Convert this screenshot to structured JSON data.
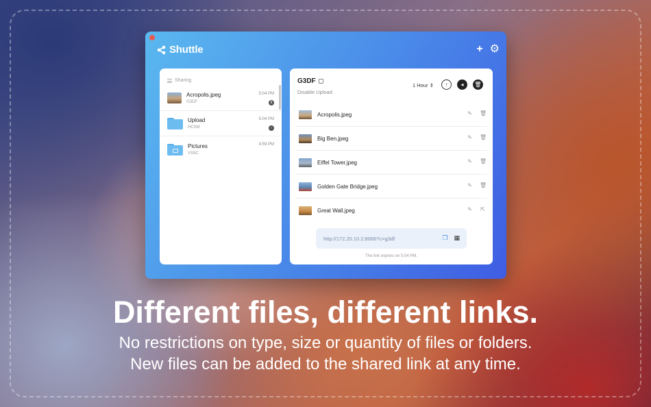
{
  "app": {
    "name": "Shuttle",
    "add_icon": "plus-icon",
    "settings_icon": "gear-icon"
  },
  "sidebar": {
    "section_label": "Sharing",
    "items": [
      {
        "name": "Acropolis.jpeg",
        "code": "G3DF",
        "time": "5:04 PM",
        "badge": "8",
        "kind": "photo"
      },
      {
        "name": "Upload",
        "code": "HCSM",
        "time": "5:04 PM",
        "badge": "↑",
        "kind": "folder"
      },
      {
        "name": "Pictures",
        "code": "VX8C",
        "time": "4:59 PM",
        "badge": "",
        "kind": "folder-pictures"
      }
    ]
  },
  "detail": {
    "title": "G3DF",
    "subtitle": "Disable Upload",
    "duration": "1 Hour",
    "files": [
      {
        "name": "Acropolis.jpeg",
        "actions": [
          "edit-icon",
          "trash-icon"
        ]
      },
      {
        "name": "Big Ben.jpeg",
        "actions": [
          "edit-icon",
          "trash-icon"
        ]
      },
      {
        "name": "Eiffel Tower.jpeg",
        "actions": [
          "edit-icon",
          "trash-icon"
        ]
      },
      {
        "name": "Golden Gate Bridge.jpeg",
        "actions": [
          "edit-icon",
          "trash-icon"
        ]
      },
      {
        "name": "Great Wall.jpeg",
        "actions": [
          "edit-icon",
          "folder-out-icon"
        ]
      }
    ],
    "link": "http://172.20.10.2:8066?c=g3df",
    "expires": "The link expires on 5:04 PM."
  },
  "marketing": {
    "headline": "Different files, different links.",
    "line1": "No restrictions on type, size or quantity of files or folders.",
    "line2": "New files can be added to the shared link at any time."
  },
  "colors": {
    "window_gradient_start": "#5ab8ef",
    "window_gradient_end": "#3f5de3",
    "accent": "#4a90e2"
  }
}
